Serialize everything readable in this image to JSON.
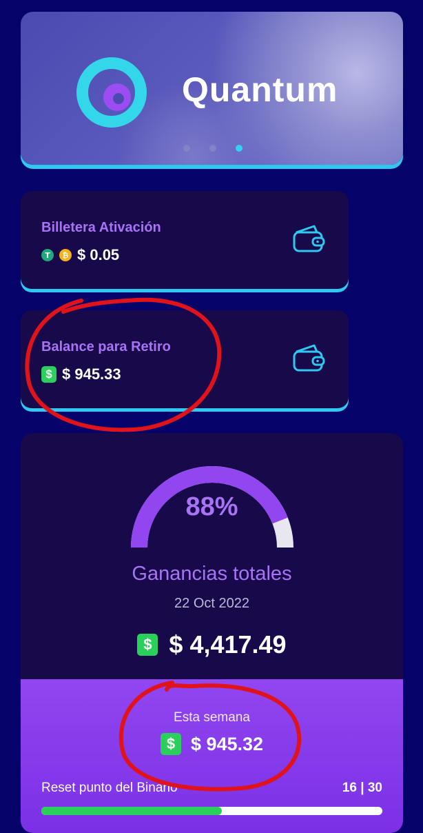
{
  "banner": {
    "logo_text": "Quantum",
    "carousel_active_index": 2,
    "carousel_count": 3
  },
  "wallets": [
    {
      "title": "Billetera Ativación",
      "value": "$ 0.05",
      "icons": [
        "tether-icon",
        "bitcoin-icon"
      ]
    },
    {
      "title": "Balance para Retiro",
      "value": "$ 945.33",
      "icons": [
        "dollar-icon"
      ]
    }
  ],
  "earnings": {
    "percent_label": "88%",
    "percent_value": 0.88,
    "title": "Ganancias totales",
    "date": "22 Oct 2022",
    "total": "$ 4,417.49"
  },
  "week": {
    "label": "Esta semana",
    "value": "$ 945.32",
    "reset_label": "Reset punto del Binario",
    "reset_count": "16 | 30",
    "reset_progress": 0.53
  },
  "colors": {
    "background": "#050269",
    "accent_cyan": "#2ec8f0",
    "accent_purple": "#a874f5",
    "gauge_fill": "#9146f0",
    "gauge_track": "#e8e6ef",
    "money_green": "#2ad05b",
    "annotation_red": "#e0131b"
  }
}
